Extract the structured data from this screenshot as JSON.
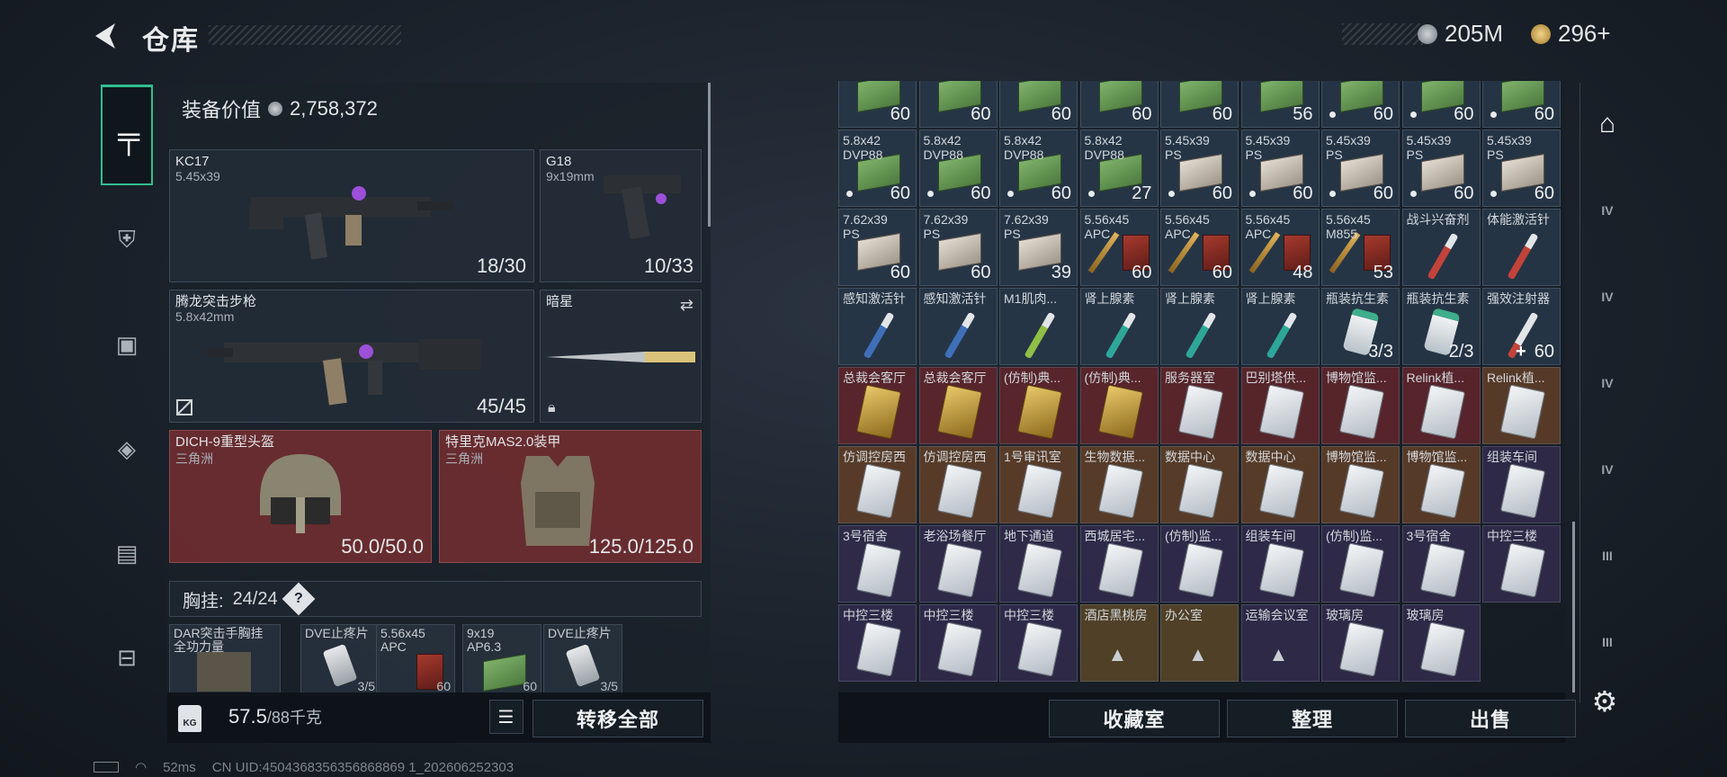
{
  "header": {
    "title": "仓库"
  },
  "currency": {
    "cash": "205M",
    "coins": "296+"
  },
  "equipment": {
    "label": "装备价值",
    "value": "2,758,372"
  },
  "weapons": [
    {
      "name": "KC17",
      "caliber": "5.45x39",
      "ammo": "18/30"
    },
    {
      "name": "G18",
      "caliber": "9x19mm",
      "ammo": "10/33"
    },
    {
      "name": "腾龙突击步枪",
      "caliber": "5.8x42mm",
      "ammo": "45/45"
    },
    {
      "name": "暗星",
      "caliber": "",
      "ammo": ""
    }
  ],
  "armor": [
    {
      "name": "DICH-9重型头盔",
      "sub": "三角洲",
      "durability": "50.0/50.0"
    },
    {
      "name": "特里克MAS2.0装甲",
      "sub": "三角洲",
      "durability": "125.0/125.0"
    }
  ],
  "chest_rig": {
    "label": "胸挂:",
    "capacity": "24/24"
  },
  "rig_items": [
    {
      "name": "DAR突击手胸挂\n全功力量",
      "count": ""
    },
    {
      "name": "DVE止疼片",
      "count": "3/5"
    },
    {
      "name": "5.56x45\nAPC",
      "count": "60"
    },
    {
      "name": "9x19\nAP6.3",
      "count": "60"
    },
    {
      "name": "DVE止疼片",
      "count": "3/5"
    }
  ],
  "weight": {
    "current": "57.5",
    "max": "/88千克"
  },
  "buttons": {
    "transfer_all": "转移全部",
    "collection": "收藏室",
    "organize": "整理",
    "sell": "出售"
  },
  "grid": [
    {
      "name": "5...",
      "count": "60",
      "icon": "ammo-green",
      "bg": "blue",
      "dot": false
    },
    {
      "name": "5...",
      "count": "60",
      "icon": "ammo-green",
      "bg": "blue",
      "dot": false
    },
    {
      "name": "5...",
      "count": "60",
      "icon": "ammo-green",
      "bg": "blue",
      "dot": false
    },
    {
      "name": "5...",
      "count": "60",
      "icon": "ammo-green",
      "bg": "blue",
      "dot": false
    },
    {
      "name": "5...",
      "count": "60",
      "icon": "ammo-green",
      "bg": "blue",
      "dot": false
    },
    {
      "name": "5...",
      "count": "56",
      "icon": "ammo-green",
      "bg": "blue",
      "dot": false
    },
    {
      "name": "5...",
      "count": "60",
      "icon": "ammo-green",
      "bg": "blue",
      "dot": true
    },
    {
      "name": "5...",
      "count": "60",
      "icon": "ammo-green",
      "bg": "blue",
      "dot": true
    },
    {
      "name": "5.8x42\nDVP88",
      "count": "60",
      "icon": "ammo-green",
      "bg": "blue",
      "dot": true
    },
    {
      "name": "5.8x42\nDVP88",
      "count": "60",
      "icon": "ammo-green",
      "bg": "blue",
      "dot": true
    },
    {
      "name": "5.8x42\nDVP88",
      "count": "60",
      "icon": "ammo-green",
      "bg": "blue",
      "dot": true
    },
    {
      "name": "5.8x42\nDVP88",
      "count": "60",
      "icon": "ammo-green",
      "bg": "blue",
      "dot": true
    },
    {
      "name": "5.8x42\nDVP88",
      "count": "27",
      "icon": "ammo-green",
      "bg": "blue",
      "dot": true
    },
    {
      "name": "5.45x39\nPS",
      "count": "60",
      "icon": "ammo-white",
      "bg": "blue",
      "dot": true
    },
    {
      "name": "5.45x39\nPS",
      "count": "60",
      "icon": "ammo-white",
      "bg": "blue",
      "dot": true
    },
    {
      "name": "5.45x39\nPS",
      "count": "60",
      "icon": "ammo-white",
      "bg": "blue",
      "dot": true
    },
    {
      "name": "5.45x39\nPS",
      "count": "60",
      "icon": "ammo-white",
      "bg": "blue",
      "dot": true
    },
    {
      "name": "5.45x39\nPS",
      "count": "60",
      "icon": "ammo-white",
      "bg": "blue",
      "dot": true
    },
    {
      "name": "7.62x39\nPS",
      "count": "60",
      "icon": "ammo-white",
      "bg": "blue",
      "dot": false
    },
    {
      "name": "7.62x39\nPS",
      "count": "60",
      "icon": "ammo-white",
      "bg": "blue",
      "dot": false
    },
    {
      "name": "7.62x39\nPS",
      "count": "39",
      "icon": "ammo-white",
      "bg": "blue",
      "dot": false
    },
    {
      "name": "5.56x45\nAPC",
      "count": "60",
      "icon": "ammo-red",
      "bg": "blue",
      "dot": false
    },
    {
      "name": "5.56x45\nAPC",
      "count": "60",
      "icon": "ammo-red",
      "bg": "blue",
      "dot": false
    },
    {
      "name": "5.56x45\nAPC",
      "count": "48",
      "icon": "ammo-red",
      "bg": "blue",
      "dot": false
    },
    {
      "name": "5.56x45\nM855",
      "count": "53",
      "icon": "ammo-red",
      "bg": "blue",
      "dot": false
    },
    {
      "name": "战斗兴奋剂",
      "count": "",
      "icon": "syringe-red",
      "bg": "blue",
      "dot": false
    },
    {
      "name": "体能激活针",
      "count": "",
      "icon": "syringe-red",
      "bg": "blue",
      "dot": false
    },
    {
      "name": "感知激活针",
      "count": "",
      "icon": "syringe-blue",
      "bg": "blue",
      "dot": false
    },
    {
      "name": "感知激活针",
      "count": "",
      "icon": "syringe-blue",
      "bg": "blue",
      "dot": false
    },
    {
      "name": "M1肌肉...",
      "count": "",
      "icon": "syringe-green",
      "bg": "blue",
      "dot": false
    },
    {
      "name": "肾上腺素",
      "count": "",
      "icon": "syringe-teal",
      "bg": "blue",
      "dot": false
    },
    {
      "name": "肾上腺素",
      "count": "",
      "icon": "syringe-teal",
      "bg": "blue",
      "dot": false
    },
    {
      "name": "肾上腺素",
      "count": "",
      "icon": "syringe-teal",
      "bg": "blue",
      "dot": false
    },
    {
      "name": "瓶装抗生素",
      "count": "3/3",
      "icon": "bottle",
      "bg": "blue",
      "dot": false
    },
    {
      "name": "瓶装抗生素",
      "count": "2/3",
      "icon": "bottle",
      "bg": "blue",
      "dot": false
    },
    {
      "name": "强效注射器",
      "count": "60",
      "icon": "syringe-white",
      "bg": "blue",
      "dot": false,
      "plus": true
    },
    {
      "name": "总裁会客厅",
      "count": "",
      "icon": "card-gold",
      "bg": "red",
      "dot": false
    },
    {
      "name": "总裁会客厅",
      "count": "",
      "icon": "card-gold",
      "bg": "red",
      "dot": false
    },
    {
      "name": "(仿制)典...",
      "count": "",
      "icon": "card-gold",
      "bg": "red",
      "dot": false
    },
    {
      "name": "(仿制)典...",
      "count": "",
      "icon": "card-gold",
      "bg": "red",
      "dot": false
    },
    {
      "name": "服务器室",
      "count": "",
      "icon": "card-white",
      "bg": "red",
      "dot": false
    },
    {
      "name": "巴别塔供...",
      "count": "",
      "icon": "card-white",
      "bg": "red",
      "dot": false
    },
    {
      "name": "博物馆监...",
      "count": "",
      "icon": "card-white",
      "bg": "red",
      "dot": false
    },
    {
      "name": "Relink植...",
      "count": "",
      "icon": "card-white",
      "bg": "red",
      "dot": false
    },
    {
      "name": "Relink植...",
      "count": "",
      "icon": "card-white",
      "bg": "brown",
      "dot": false
    },
    {
      "name": "仿调控房西",
      "count": "",
      "icon": "card-white",
      "bg": "brown",
      "dot": false
    },
    {
      "name": "仿调控房西",
      "count": "",
      "icon": "card-white",
      "bg": "brown",
      "dot": false
    },
    {
      "name": "1号审讯室",
      "count": "",
      "icon": "card-white",
      "bg": "brown",
      "dot": false
    },
    {
      "name": "生物数据...",
      "count": "",
      "icon": "card-white",
      "bg": "brown",
      "dot": false
    },
    {
      "name": "数据中心",
      "count": "",
      "icon": "card-white",
      "bg": "brown",
      "dot": false
    },
    {
      "name": "数据中心",
      "count": "",
      "icon": "card-white",
      "bg": "brown",
      "dot": false
    },
    {
      "name": "博物馆监...",
      "count": "",
      "icon": "card-white",
      "bg": "brown",
      "dot": false
    },
    {
      "name": "博物馆监...",
      "count": "",
      "icon": "card-white",
      "bg": "brown",
      "dot": false
    },
    {
      "name": "组装车间",
      "count": "",
      "icon": "card-white",
      "bg": "purple",
      "dot": false
    },
    {
      "name": "3号宿舍",
      "count": "",
      "icon": "card-white",
      "bg": "purple",
      "dot": false
    },
    {
      "name": "老浴场餐厅",
      "count": "",
      "icon": "card-white",
      "bg": "purple",
      "dot": false
    },
    {
      "name": "地下通道",
      "count": "",
      "icon": "card-white",
      "bg": "purple",
      "dot": false
    },
    {
      "name": "西城居宅...",
      "count": "",
      "icon": "card-white",
      "bg": "purple",
      "dot": false
    },
    {
      "name": "(仿制)监...",
      "count": "",
      "icon": "card-white",
      "bg": "purple",
      "dot": false
    },
    {
      "name": "组装车间",
      "count": "",
      "icon": "card-white",
      "bg": "purple",
      "dot": false
    },
    {
      "name": "(仿制)监...",
      "count": "",
      "icon": "card-white",
      "bg": "purple",
      "dot": false
    },
    {
      "name": "3号宿舍",
      "count": "",
      "icon": "card-white",
      "bg": "purple",
      "dot": false
    },
    {
      "name": "中控三楼",
      "count": "",
      "icon": "card-white",
      "bg": "purple",
      "dot": false
    },
    {
      "name": "中控三楼",
      "count": "",
      "icon": "card-white",
      "bg": "purple",
      "dot": false
    },
    {
      "name": "中控三楼",
      "count": "",
      "icon": "card-white",
      "bg": "purple",
      "dot": false
    },
    {
      "name": "中控三楼",
      "count": "",
      "icon": "card-white",
      "bg": "purple",
      "dot": false
    },
    {
      "name": "酒店黑桃房",
      "count": "",
      "icon": "locked",
      "bg": "gold",
      "dot": false
    },
    {
      "name": "办公室",
      "count": "",
      "icon": "locked",
      "bg": "gold",
      "dot": false
    },
    {
      "name": "运输会议室",
      "count": "",
      "icon": "locked",
      "bg": "purple",
      "dot": false
    },
    {
      "name": "玻璃房",
      "count": "",
      "icon": "card-white",
      "bg": "purple",
      "dot": false
    },
    {
      "name": "玻璃房",
      "count": "",
      "icon": "card-white",
      "bg": "purple",
      "dot": false
    }
  ],
  "right_nav": [
    "home-icon",
    "IV",
    "IV",
    "IV",
    "IV",
    "III",
    "III",
    "III",
    "gear-icon"
  ],
  "status": {
    "ping": "52ms",
    "uid": "CN UID:4504368356356868869 1_202606252303"
  },
  "colors": {
    "accent": "#2fbf8f",
    "red_slot": "#762e30"
  }
}
